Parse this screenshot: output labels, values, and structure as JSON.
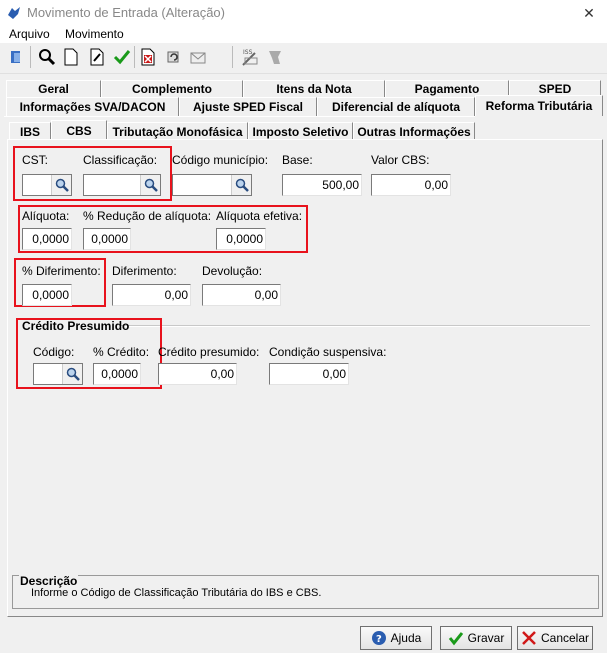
{
  "window": {
    "title": "Movimento de Entrada (Alteração)",
    "close_glyph": "✕"
  },
  "menu": {
    "items": [
      "Arquivo",
      "Movimento"
    ]
  },
  "toolbar": {
    "icons": [
      "exit-icon",
      "search-icon",
      "new-icon",
      "edit-icon",
      "confirm-icon",
      "delete-icon",
      "refresh-icon",
      "mail-icon",
      "iss-icon",
      "print-icon"
    ]
  },
  "tabs_row1": [
    "Geral",
    "Complemento",
    "Itens da Nota",
    "Pagamento",
    "SPED"
  ],
  "tabs_row2": [
    "Informações SVA/DACON",
    "Ajuste SPED Fiscal",
    "Diferencial de alíquota",
    "Reforma Tributária"
  ],
  "subtabs": [
    "IBS",
    "CBS",
    "Tributação Monofásica",
    "Imposto Seletivo",
    "Outras Informações"
  ],
  "selected_subtab": "CBS",
  "form": {
    "cst_label": "CST:",
    "classificacao_label": "Classificação:",
    "codigo_municipio_label": "Código município:",
    "base_label": "Base:",
    "base_value": "500,00",
    "valor_cbs_label": "Valor CBS:",
    "valor_cbs_value": "0,00",
    "aliquota_label": "Alíquota:",
    "aliquota_value": "0,0000",
    "reducao_label": "% Redução de alíquota:",
    "reducao_value": "0,0000",
    "aliquota_efetiva_label": "Alíquota efetiva:",
    "aliquota_efetiva_value": "0,0000",
    "perc_diferimento_label": "% Diferimento:",
    "perc_diferimento_value": "0,0000",
    "diferimento_label": "Diferimento:",
    "diferimento_value": "0,00",
    "devolucao_label": "Devolução:",
    "devolucao_value": "0,00"
  },
  "credito": {
    "section_title": "Crédito Presumido",
    "codigo_label": "Código:",
    "perc_credito_label": "% Crédito:",
    "perc_credito_value": "0,0000",
    "credito_presumido_label": "Crédito presumido:",
    "credito_presumido_value": "0,00",
    "condicao_label": "Condição suspensiva:",
    "condicao_value": "0,00"
  },
  "descricao": {
    "title": "Descrição",
    "text": "Informe o Código de Classificação Tributária do IBS e CBS."
  },
  "buttons": {
    "ajuda": "Ajuda",
    "gravar": "Gravar",
    "cancelar": "Cancelar"
  },
  "colors": {
    "highlight": "#e8121c",
    "confirm": "#1a9a1a",
    "help": "#2a5db0"
  }
}
